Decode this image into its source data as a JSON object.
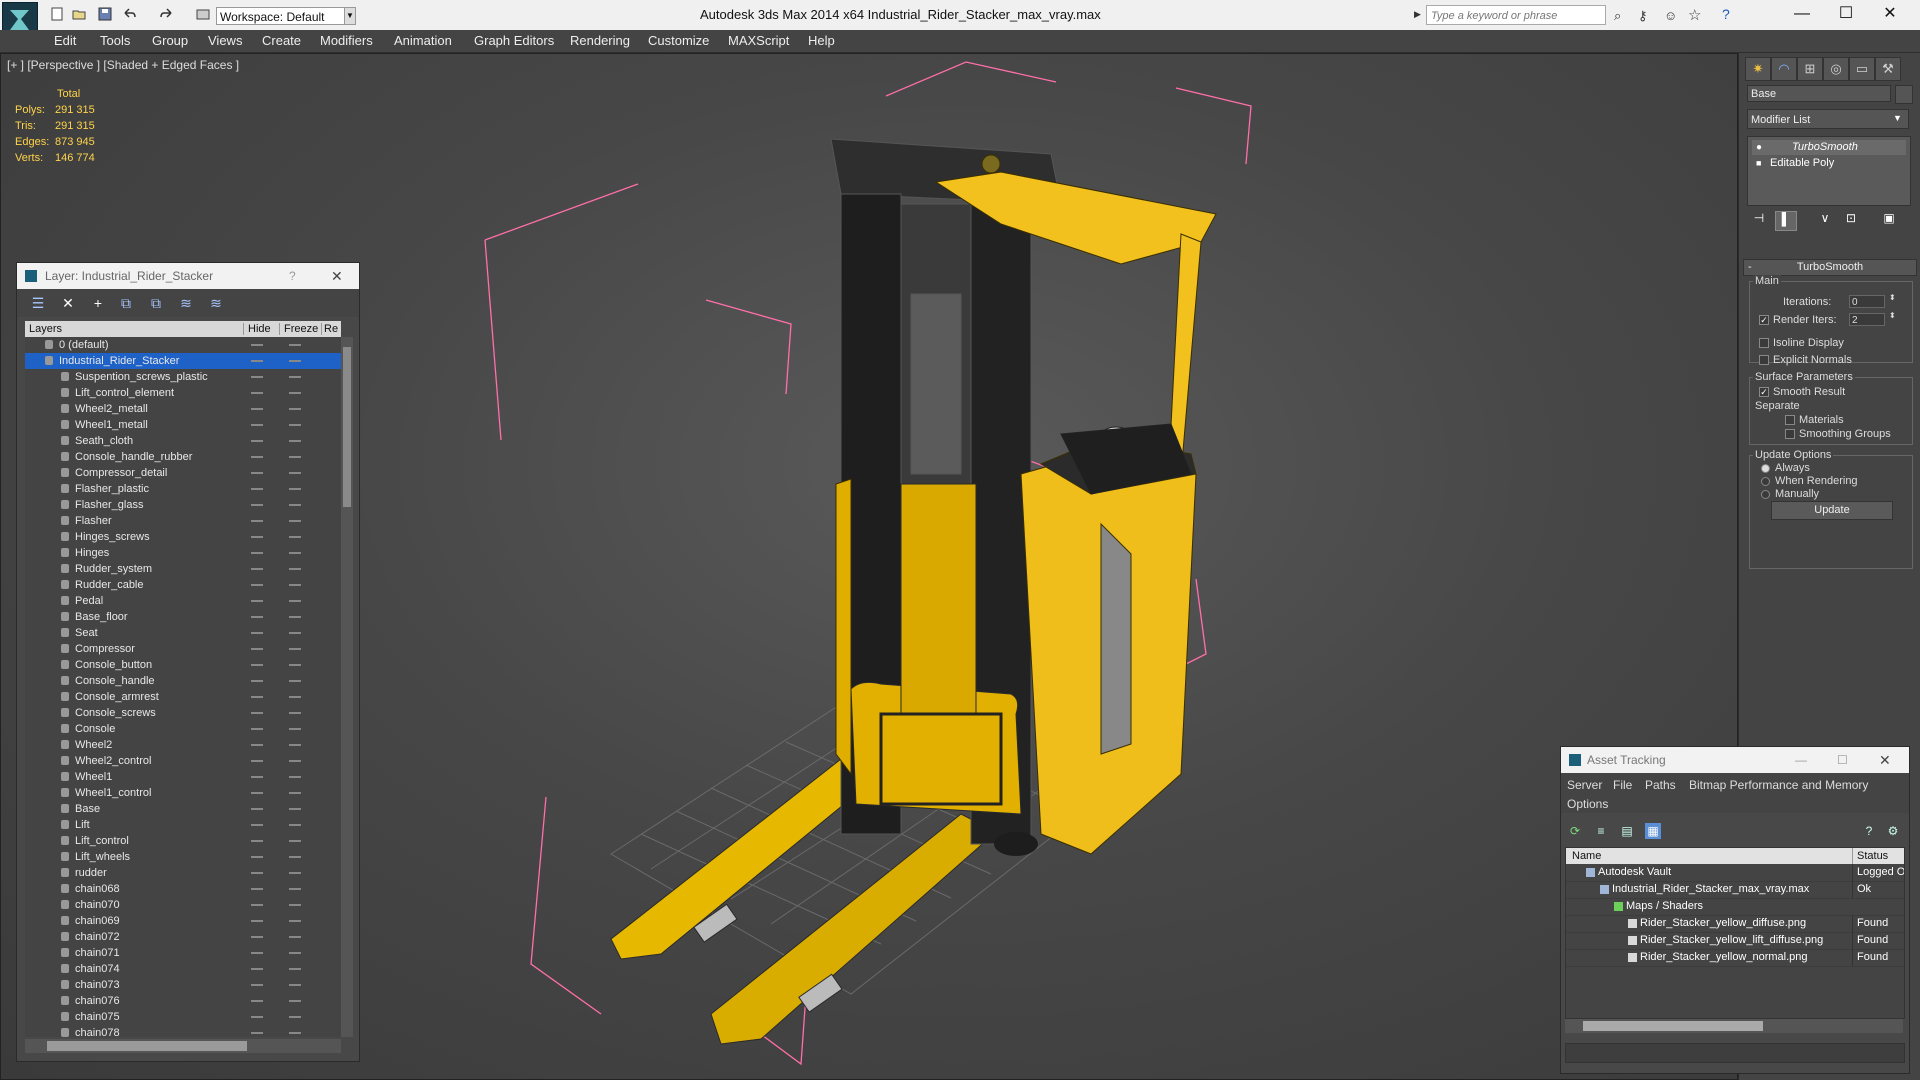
{
  "app": {
    "title": "Autodesk 3ds Max  2014 x64     Industrial_Rider_Stacker_max_vray.max",
    "workspace": "Workspace: Default",
    "search_placeholder": "Type a keyword or phrase",
    "win_min": "—",
    "win_max": "☐",
    "win_close": "✕"
  },
  "menu": [
    "Edit",
    "Tools",
    "Group",
    "Views",
    "Create",
    "Modifiers",
    "Animation",
    "Graph Editors",
    "Rendering",
    "Customize",
    "MAXScript",
    "Help"
  ],
  "viewport": {
    "label": "[+ ] [Perspective ] [Shaded + Edged Faces ]",
    "stats": {
      "header": "Total",
      "rows": [
        {
          "label": "Polys:",
          "value": "291 315"
        },
        {
          "label": "Tris:",
          "value": "291 315"
        },
        {
          "label": "Edges:",
          "value": "873 945"
        },
        {
          "label": "Verts:",
          "value": "146 774"
        }
      ]
    }
  },
  "layer_panel": {
    "title": "Layer: Industrial_Rider_Stacker",
    "help": "?",
    "close": "✕",
    "columns": {
      "layers": "Layers",
      "hide": "Hide",
      "freeze": "Freeze",
      "render": "Re"
    },
    "layers": [
      {
        "name": "0 (default)",
        "level": 0
      },
      {
        "name": "Industrial_Rider_Stacker",
        "level": 0,
        "selected": true
      },
      {
        "name": "Suspention_screws_plastic",
        "level": 1
      },
      {
        "name": "Lift_control_element",
        "level": 1
      },
      {
        "name": "Wheel2_metall",
        "level": 1
      },
      {
        "name": "Wheel1_metall",
        "level": 1
      },
      {
        "name": "Seath_cloth",
        "level": 1
      },
      {
        "name": "Console_handle_rubber",
        "level": 1
      },
      {
        "name": "Compressor_detail",
        "level": 1
      },
      {
        "name": "Flasher_plastic",
        "level": 1
      },
      {
        "name": "Flasher_glass",
        "level": 1
      },
      {
        "name": "Flasher",
        "level": 1
      },
      {
        "name": "Hinges_screws",
        "level": 1
      },
      {
        "name": "Hinges",
        "level": 1
      },
      {
        "name": "Rudder_system",
        "level": 1
      },
      {
        "name": "Rudder_cable",
        "level": 1
      },
      {
        "name": "Pedal",
        "level": 1
      },
      {
        "name": "Base_floor",
        "level": 1
      },
      {
        "name": "Seat",
        "level": 1
      },
      {
        "name": "Compressor",
        "level": 1
      },
      {
        "name": "Console_button",
        "level": 1
      },
      {
        "name": "Console_handle",
        "level": 1
      },
      {
        "name": "Console_armrest",
        "level": 1
      },
      {
        "name": "Console_screws",
        "level": 1
      },
      {
        "name": "Console",
        "level": 1
      },
      {
        "name": "Wheel2",
        "level": 1
      },
      {
        "name": "Wheel2_control",
        "level": 1
      },
      {
        "name": "Wheel1",
        "level": 1
      },
      {
        "name": "Wheel1_control",
        "level": 1
      },
      {
        "name": "Base",
        "level": 1
      },
      {
        "name": "Lift",
        "level": 1
      },
      {
        "name": "Lift_control",
        "level": 1
      },
      {
        "name": "Lift_wheels",
        "level": 1
      },
      {
        "name": "rudder",
        "level": 1
      },
      {
        "name": "chain068",
        "level": 1
      },
      {
        "name": "chain070",
        "level": 1
      },
      {
        "name": "chain069",
        "level": 1
      },
      {
        "name": "chain072",
        "level": 1
      },
      {
        "name": "chain071",
        "level": 1
      },
      {
        "name": "chain074",
        "level": 1
      },
      {
        "name": "chain073",
        "level": 1
      },
      {
        "name": "chain076",
        "level": 1
      },
      {
        "name": "chain075",
        "level": 1
      },
      {
        "name": "chain078",
        "level": 1
      }
    ]
  },
  "command_panel": {
    "object_name": "Base",
    "modifier_list": "Modifier List",
    "stack": [
      "TurboSmooth",
      "Editable Poly"
    ],
    "rollout_title": "TurboSmooth",
    "main_label": "Main",
    "iterations_label": "Iterations:",
    "iterations_value": "0",
    "render_iters_label": "Render Iters:",
    "render_iters_value": "2",
    "isoline_label": "Isoline Display",
    "explicit_label": "Explicit Normals",
    "surface_label": "Surface Parameters",
    "smooth_label": "Smooth Result",
    "separate_label": "Separate",
    "materials_label": "Materials",
    "smoothing_label": "Smoothing Groups",
    "update_options_label": "Update Options",
    "always_label": "Always",
    "when_rendering_label": "When Rendering",
    "manually_label": "Manually",
    "update_button": "Update"
  },
  "asset_tracking": {
    "title": "Asset Tracking",
    "menu": [
      "Server",
      "File",
      "Paths",
      "Bitmap Performance and Memory",
      "Options"
    ],
    "columns": {
      "name": "Name",
      "status": "Status"
    },
    "rows": [
      {
        "name": "Autodesk Vault",
        "status": "Logged O",
        "indent": 0
      },
      {
        "name": "Industrial_Rider_Stacker_max_vray.max",
        "status": "Ok",
        "indent": 1
      },
      {
        "name": "Maps / Shaders",
        "status": "",
        "indent": 2
      },
      {
        "name": "Rider_Stacker_yellow_diffuse.png",
        "status": "Found",
        "indent": 3
      },
      {
        "name": "Rider_Stacker_yellow_lift_diffuse.png",
        "status": "Found",
        "indent": 3
      },
      {
        "name": "Rider_Stacker_yellow_normal.png",
        "status": "Found",
        "indent": 3
      }
    ]
  },
  "colors": {
    "accent": "#f2c11e",
    "selection": "#1e62c8",
    "bbox": "#ff6fa8",
    "stats": "#ffd34a"
  }
}
